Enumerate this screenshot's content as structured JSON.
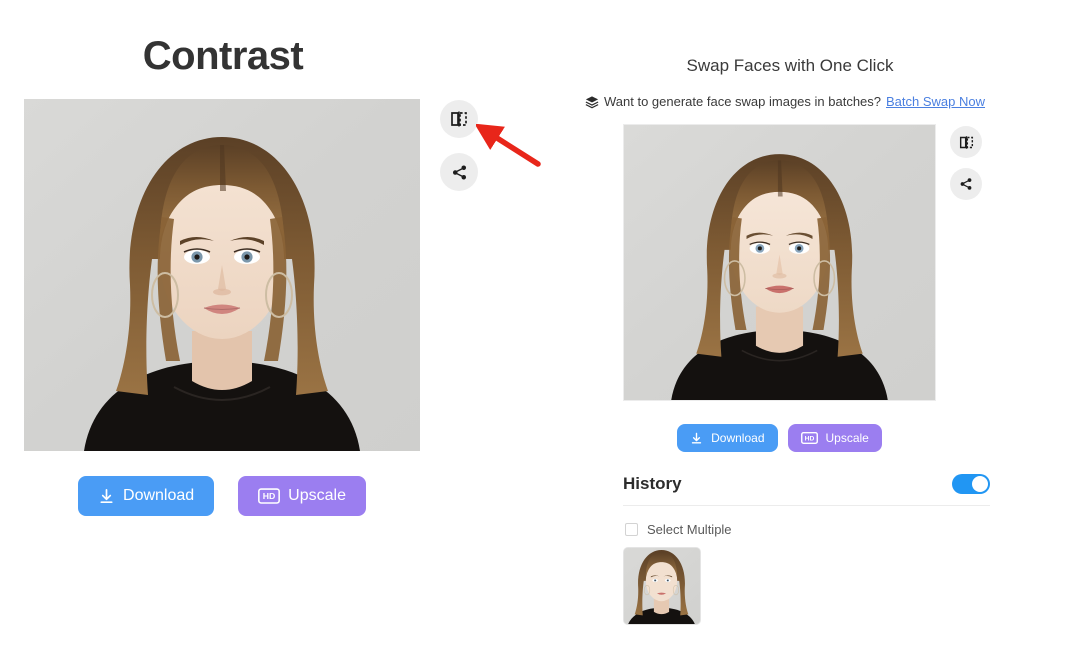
{
  "left": {
    "title": "Contrast",
    "image_alt": "portrait-photo-woman-brown-hair-hoop-earrings-black-top",
    "compare_icon": "compare-split-icon",
    "share_icon": "share-icon",
    "download_label": "Download",
    "upscale_label": "Upscale",
    "upscale_badge": "HD",
    "annotation": "red-arrow-pointing-to-compare-button"
  },
  "right": {
    "title": "Swap Faces with One Click",
    "batch_icon": "layers-stack-icon",
    "batch_question": "Want to generate face swap images in batches?",
    "batch_link": "Batch Swap Now",
    "image_alt": "portrait-photo-woman-brown-hair-hoop-earrings-black-top",
    "compare_icon": "compare-split-icon",
    "share_icon": "share-icon",
    "download_label": "Download",
    "upscale_label": "Upscale",
    "upscale_badge": "HD",
    "history": {
      "title": "History",
      "toggle_state": "on",
      "select_multiple_label": "Select Multiple",
      "select_multiple_checked": false,
      "thumbnails": [
        {
          "alt": "history-thumbnail-portrait-woman"
        }
      ]
    }
  },
  "colors": {
    "download_blue": "#4a9cf5",
    "upscale_purple": "#9b7ef0",
    "link_blue": "#4a7fe0",
    "toggle_blue": "#2196f3",
    "annotation_red": "#e8261a",
    "title_dark": "#333333"
  }
}
